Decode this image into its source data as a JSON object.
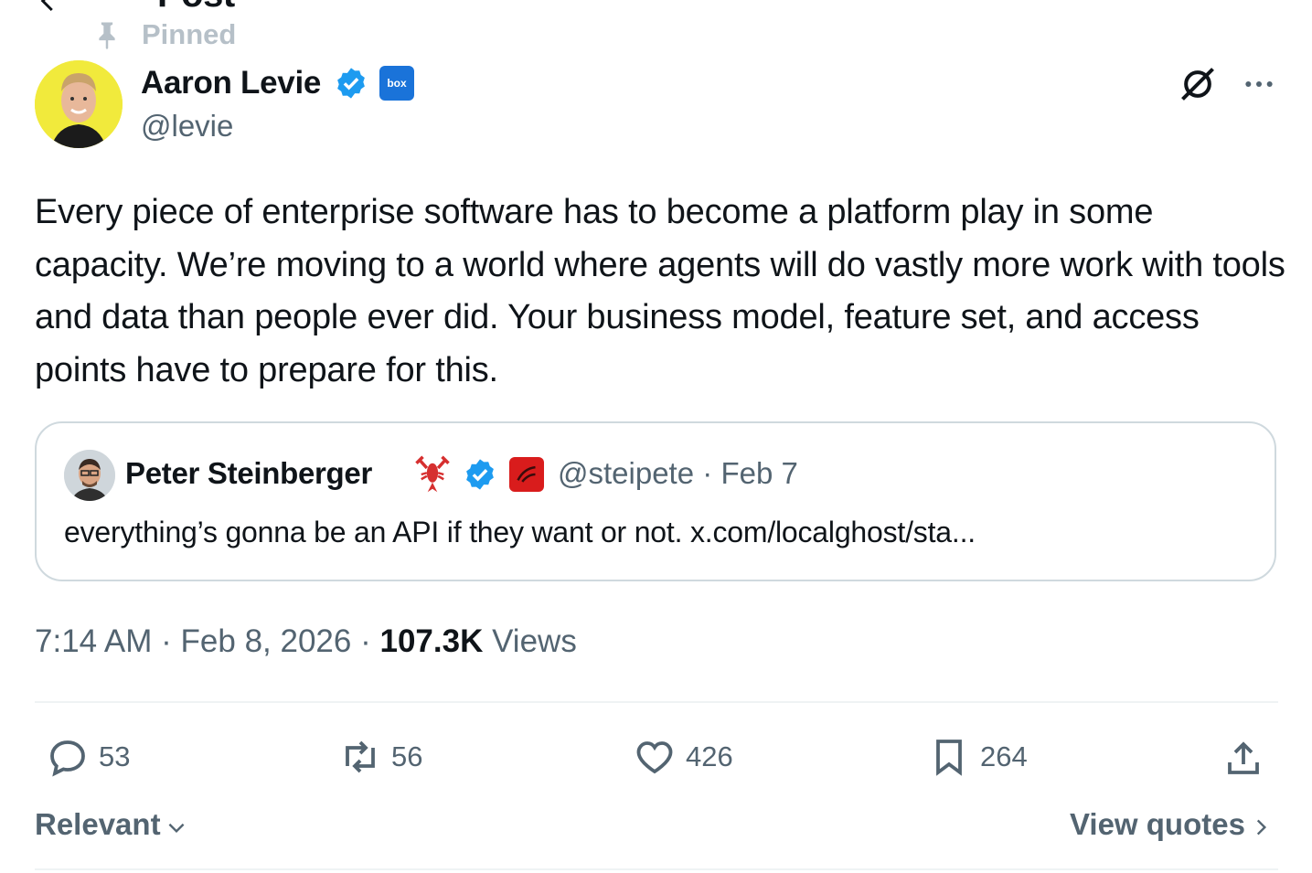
{
  "header": {
    "title": "Post",
    "pinned_label": "Pinned"
  },
  "author": {
    "name": "Aaron Levie",
    "handle": "@levie",
    "affiliate_badge": "box"
  },
  "tweet": {
    "text": "Every piece of enterprise software has to become a platform play in some capacity. We’re moving to a world where agents will do vastly more work with tools and data than people ever did. Your business model, feature set, and access points have to prepare for this."
  },
  "quote": {
    "name": "Peter Steinberger",
    "handle": "@steipete",
    "separator": "·",
    "date": "Feb 7",
    "text": "everything’s gonna be an API if they want or not. x.com/localghost/sta..."
  },
  "meta": {
    "time": "7:14 AM",
    "separator": "·",
    "date": "Feb 8, 2026",
    "views_count": "107.3K",
    "views_label": "Views"
  },
  "actions": {
    "replies": "53",
    "reposts": "56",
    "likes": "426",
    "bookmarks": "264"
  },
  "footer": {
    "sort_label": "Relevant",
    "view_quotes_label": "View quotes"
  },
  "colors": {
    "verified": "#1d9bf0",
    "muted": "#536471",
    "border": "#cfd9de",
    "box_badge": "#1a73d9"
  },
  "icons": [
    "back-arrow-icon",
    "pin-icon",
    "verified-icon",
    "grok-icon",
    "more-icon",
    "lobster-icon",
    "reply-icon",
    "repost-icon",
    "like-icon",
    "bookmark-icon",
    "share-icon",
    "chevron-down-icon",
    "chevron-right-icon"
  ]
}
